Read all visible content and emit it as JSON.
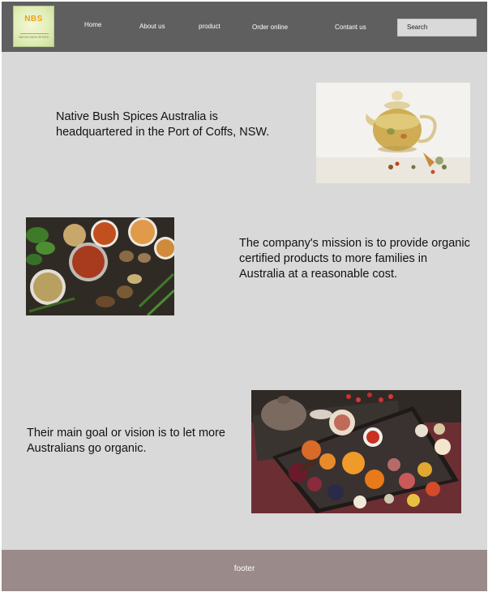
{
  "header": {
    "logo": {
      "text": "NBS",
      "subtext": "NATIVE BUSH SPICES"
    },
    "nav": {
      "home": "Home",
      "about": "About us",
      "product": "product",
      "order": "Order online",
      "contact": "Contant us"
    },
    "search": {
      "label": "Search"
    }
  },
  "sections": {
    "intro": "Native Bush Spices Australia is headquartered in the Port of Coffs, NSW.",
    "mission": "The company's mission is to provide organic certified products to more families in Australia at a reasonable cost.",
    "vision": "Their main goal or vision is to let more Australians go organic."
  },
  "images": {
    "tea": "teapot-herbal-tea-photo",
    "spices": "spice-bowls-photo",
    "dried_fruit": "dried-fruit-platter-photo"
  },
  "footer": {
    "text": "footer"
  },
  "colors": {
    "navbar": "#5f5f5f",
    "page_background": "#d9d9d9",
    "footer": "#9a8a8a",
    "logo_accent": "#e8a21b"
  }
}
